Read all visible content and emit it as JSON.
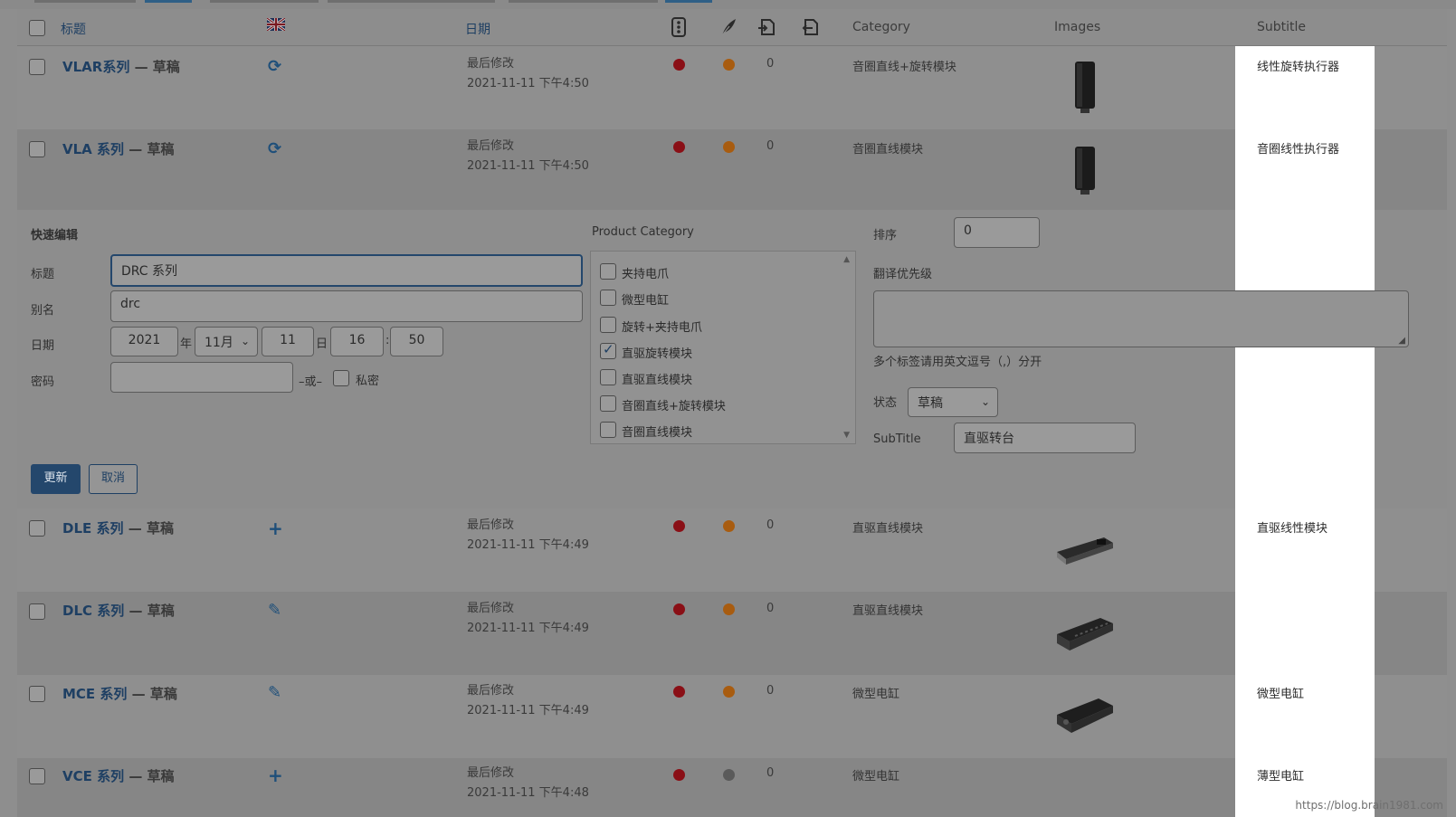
{
  "header": {
    "title": "标题",
    "date": "日期",
    "category": "Category",
    "images": "Images",
    "subtitle": "Subtitle"
  },
  "rows_top": [
    {
      "title": "VLAR系列",
      "state": "— 草稿",
      "meta1": "最后修改",
      "meta2": "2021-11-11 下午4:50",
      "count": "0",
      "category": "音圈直线+旋转模块",
      "subtitle": "线性旋转执行器"
    },
    {
      "title": "VLA 系列",
      "state": "— 草稿",
      "meta1": "最后修改",
      "meta2": "2021-11-11 下午4:50",
      "count": "0",
      "category": "音圈直线模块",
      "subtitle": "音圈线性执行器"
    }
  ],
  "quick_edit": {
    "heading": "快速编辑",
    "title_label": "标题",
    "title_value": "DRC 系列",
    "slug_label": "别名",
    "slug_value": "drc",
    "date_label": "日期",
    "year": "2021",
    "year_suffix": "年",
    "month": "11月",
    "day": "11",
    "day_suffix": "日",
    "hour": "16",
    "colon": ":",
    "minute": "50",
    "password_label": "密码",
    "or_text": "–或–",
    "private_label": "私密",
    "product_category_label": "Product Category",
    "categories": [
      {
        "label": "夹持电爪",
        "checked": false
      },
      {
        "label": "微型电缸",
        "checked": false
      },
      {
        "label": "旋转+夹持电爪",
        "checked": false
      },
      {
        "label": "直驱旋转模块",
        "checked": true
      },
      {
        "label": "直驱直线模块",
        "checked": false
      },
      {
        "label": "音圈直线+旋转模块",
        "checked": false
      },
      {
        "label": "音圈直线模块",
        "checked": false
      }
    ],
    "order_label": "排序",
    "order_value": "0",
    "translation_priority_label": "翻译优先级",
    "tags_hint": "多个标签请用英文逗号（,）分开",
    "status_label": "状态",
    "status_value": "草稿",
    "subtitle_label": "SubTitle",
    "subtitle_value": "直驱转台",
    "update_button": "更新",
    "cancel_button": "取消"
  },
  "rows_bottom": [
    {
      "title": "DLE 系列",
      "state": "— 草稿",
      "meta1": "最后修改",
      "meta2": "2021-11-11 下午4:49",
      "count": "0",
      "category": "直驱直线模块",
      "subtitle": "直驱线性模块",
      "lang_icon": "plus-icon"
    },
    {
      "title": "DLC 系列",
      "state": "— 草稿",
      "meta1": "最后修改",
      "meta2": "2021-11-11 下午4:49",
      "count": "0",
      "category": "直驱直线模块",
      "subtitle": "",
      "lang_icon": "pencil-icon"
    },
    {
      "title": "MCE 系列",
      "state": "— 草稿",
      "meta1": "最后修改",
      "meta2": "2021-11-11 下午4:49",
      "count": "0",
      "category": "微型电缸",
      "subtitle": "微型电缸",
      "lang_icon": "pencil-icon"
    },
    {
      "title": "VCE 系列",
      "state": "— 草稿",
      "meta1": "最后修改",
      "meta2": "2021-11-11 下午4:48",
      "count": "0",
      "category": "微型电缸",
      "subtitle": "薄型电缸",
      "lang_icon": "plus-icon"
    }
  ],
  "watermark": "https://blog.brain1981.com",
  "colors": {
    "accent": "#24476c",
    "dot_red": "#8a0f16",
    "dot_orange": "#a85c10",
    "dot_grey": "#5a5a5a"
  }
}
